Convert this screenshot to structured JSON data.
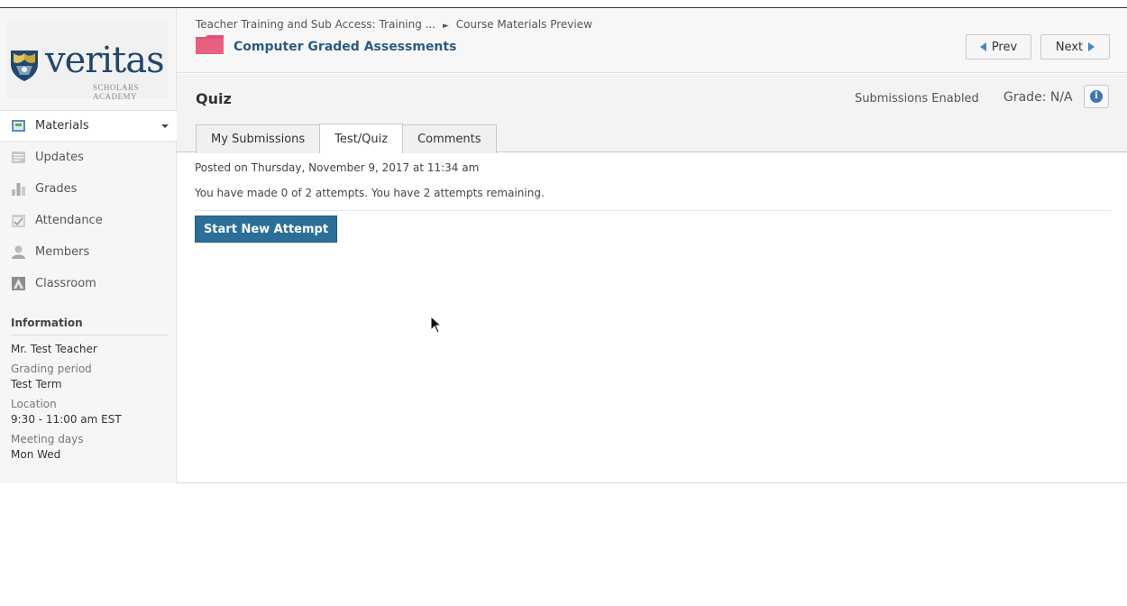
{
  "brand": {
    "name": "veritas",
    "tagline": "SCHOLARS ACADEMY",
    "colors": {
      "navy": "#23476b",
      "gold": "#c9a43a",
      "accent": "#2b6f98"
    }
  },
  "sidebar": {
    "items": [
      {
        "label": "Materials",
        "icon": "materials-icon",
        "active": true
      },
      {
        "label": "Updates",
        "icon": "updates-icon"
      },
      {
        "label": "Grades",
        "icon": "grades-icon"
      },
      {
        "label": "Attendance",
        "icon": "attendance-icon"
      },
      {
        "label": "Members",
        "icon": "members-icon"
      },
      {
        "label": "Classroom",
        "icon": "classroom-icon"
      }
    ],
    "information": {
      "title": "Information",
      "teacher": "Mr. Test Teacher",
      "grading_period_label": "Grading period",
      "grading_period_value": "Test Term",
      "location_label": "Location",
      "location_value": "9:30 - 11:00 am EST",
      "meeting_days_label": "Meeting days",
      "meeting_days_value": "Mon Wed"
    }
  },
  "header": {
    "breadcrumb_course": "Teacher Training and Sub Access: Training ...",
    "breadcrumb_separator": "►",
    "breadcrumb_page": "Course Materials Preview",
    "folder_title": "Computer Graded Assessments",
    "folder_color": "#e0507a",
    "prev_label": "Prev",
    "next_label": "Next"
  },
  "quiz": {
    "title": "Quiz",
    "submissions_status": "Submissions Enabled",
    "grade_label": "Grade:",
    "grade_value": "N/A",
    "tabs": [
      {
        "label": "My Submissions"
      },
      {
        "label": "Test/Quiz",
        "active": true
      },
      {
        "label": "Comments"
      }
    ]
  },
  "content": {
    "posted": "Posted on Thursday, November 9, 2017 at 11:34 am",
    "attempts": "You have made 0 of 2 attempts. You have 2 attempts remaining.",
    "start_button": "Start New Attempt"
  }
}
